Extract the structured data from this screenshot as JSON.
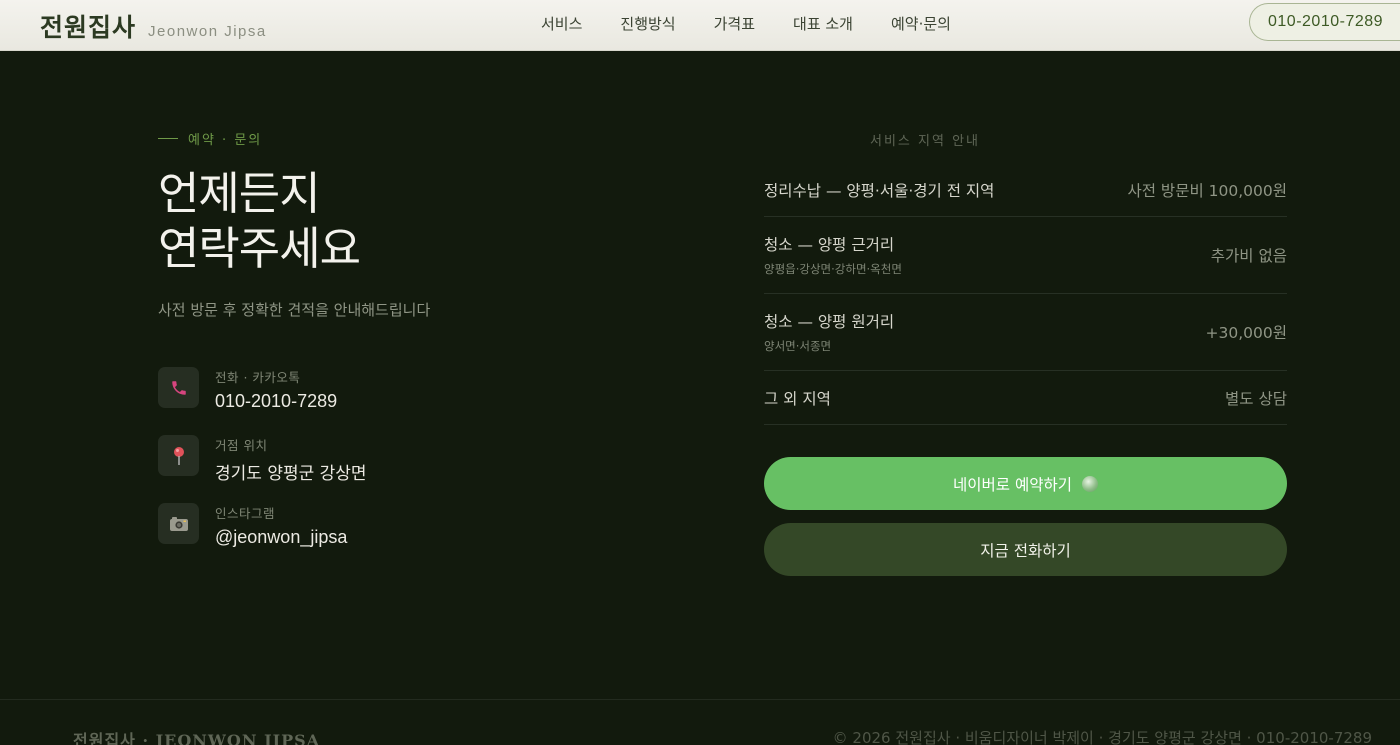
{
  "header": {
    "brand_ko": "전원집사",
    "brand_en": "Jeonwon Jipsa",
    "menu": [
      "서비스",
      "진행방식",
      "가격표",
      "대표 소개",
      "예약·문의"
    ],
    "phone": "010-2010-7289"
  },
  "contact_section": {
    "eyebrow": "예약 · 문의",
    "headline_line1": "언제든지",
    "headline_line2": "연락주세요",
    "subline": "사전 방문 후 정확한 견적을 안내해드립니다",
    "items": [
      {
        "icon": "phone-icon",
        "label": "전화 · 카카오톡",
        "value": "010-2010-7289"
      },
      {
        "icon": "location-pin-icon",
        "label": "거점 위치",
        "value": "경기도 양평군 강상면"
      },
      {
        "icon": "camera-icon",
        "label": "인스타그램",
        "value": "@jeonwon_jipsa"
      }
    ]
  },
  "service_area": {
    "title": "서비스 지역 안내",
    "rows": [
      {
        "name": "정리수납 — 양평·서울·경기 전 지역",
        "sub": "",
        "price": "사전 방문비 100,000원"
      },
      {
        "name": "청소 — 양평 근거리",
        "sub": "양평읍·강상면·강하면·옥천면",
        "price": "추가비 없음"
      },
      {
        "name": "청소 — 양평 원거리",
        "sub": "양서면·서종면",
        "price": "+30,000원"
      },
      {
        "name": "그 외 지역",
        "sub": "",
        "price": "별도 상담"
      }
    ]
  },
  "buttons": {
    "naver": "네이버로 예약하기",
    "call": "지금 전화하기"
  },
  "footer": {
    "brand": "전원집사 · JEONWON JIPSA",
    "info": "© 2026 전원집사 · 비움디자이너 박제이 · 경기도 양평군 강상면 · 010-2010-7289"
  },
  "colors": {
    "background": "#121a0d",
    "accent_green": "#67c064",
    "dark_button": "#344827",
    "eyebrow": "#6f9a48"
  }
}
